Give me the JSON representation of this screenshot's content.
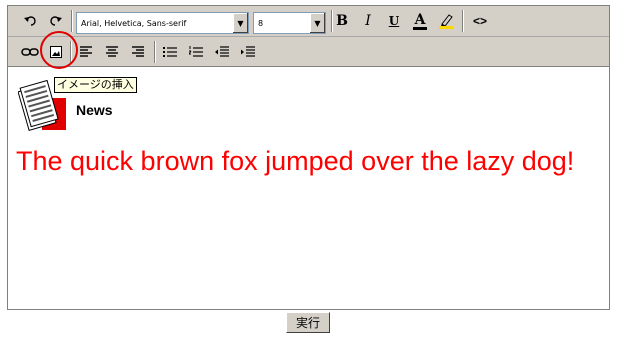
{
  "toolbar": {
    "font_family_value": "Arial, Helvetica, Sans-serif",
    "font_size_value": "8",
    "bold_label": "B",
    "italic_label": "I",
    "underline_label": "U",
    "font_color_label": "A",
    "source_label": "<>"
  },
  "tooltip": {
    "text": "イメージの挿入"
  },
  "content": {
    "logo_label": "News",
    "body_text": "The quick brown fox jumped over the lazy dog!",
    "body_text_color": "#ff0000"
  },
  "colors": {
    "toolbar_bg": "#d4d0c8",
    "highlight_circle": "#e00000",
    "highlight_bar": "#ffd700"
  },
  "icons": {
    "toolbar1": [
      "undo-icon",
      "redo-icon",
      "bold-icon",
      "italic-icon",
      "underline-icon",
      "font-color-icon",
      "highlight-icon",
      "source-icon"
    ],
    "toolbar2": [
      "link-icon",
      "insert-image-icon",
      "align-left-icon",
      "align-center-icon",
      "align-right-icon",
      "bulleted-list-icon",
      "numbered-list-icon",
      "outdent-icon",
      "indent-icon"
    ]
  },
  "submit_button": {
    "label": "実行"
  }
}
